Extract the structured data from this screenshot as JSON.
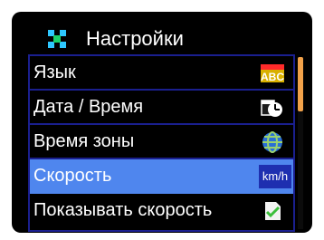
{
  "title": "Настройки",
  "menu": {
    "items": [
      {
        "label": "Язык",
        "icon": "abc-icon",
        "icon_text": "ABC"
      },
      {
        "label": "Дата / Время",
        "icon": "date-time-icon"
      },
      {
        "label": "Время зоны",
        "icon": "globe-icon"
      },
      {
        "label": "Скорость",
        "icon": "speed-unit-icon",
        "icon_text": "km/h"
      },
      {
        "label": "Показывать скорость",
        "icon": "checkmark-document-icon"
      }
    ],
    "selected_index": 3
  },
  "colors": {
    "screen_bg": "#000000",
    "row_border": "#1a1f8f",
    "selected_bg": "#4f86ee",
    "scroll_thumb": "#f2a24a"
  },
  "scroll": {
    "position_fraction": 0.0
  }
}
